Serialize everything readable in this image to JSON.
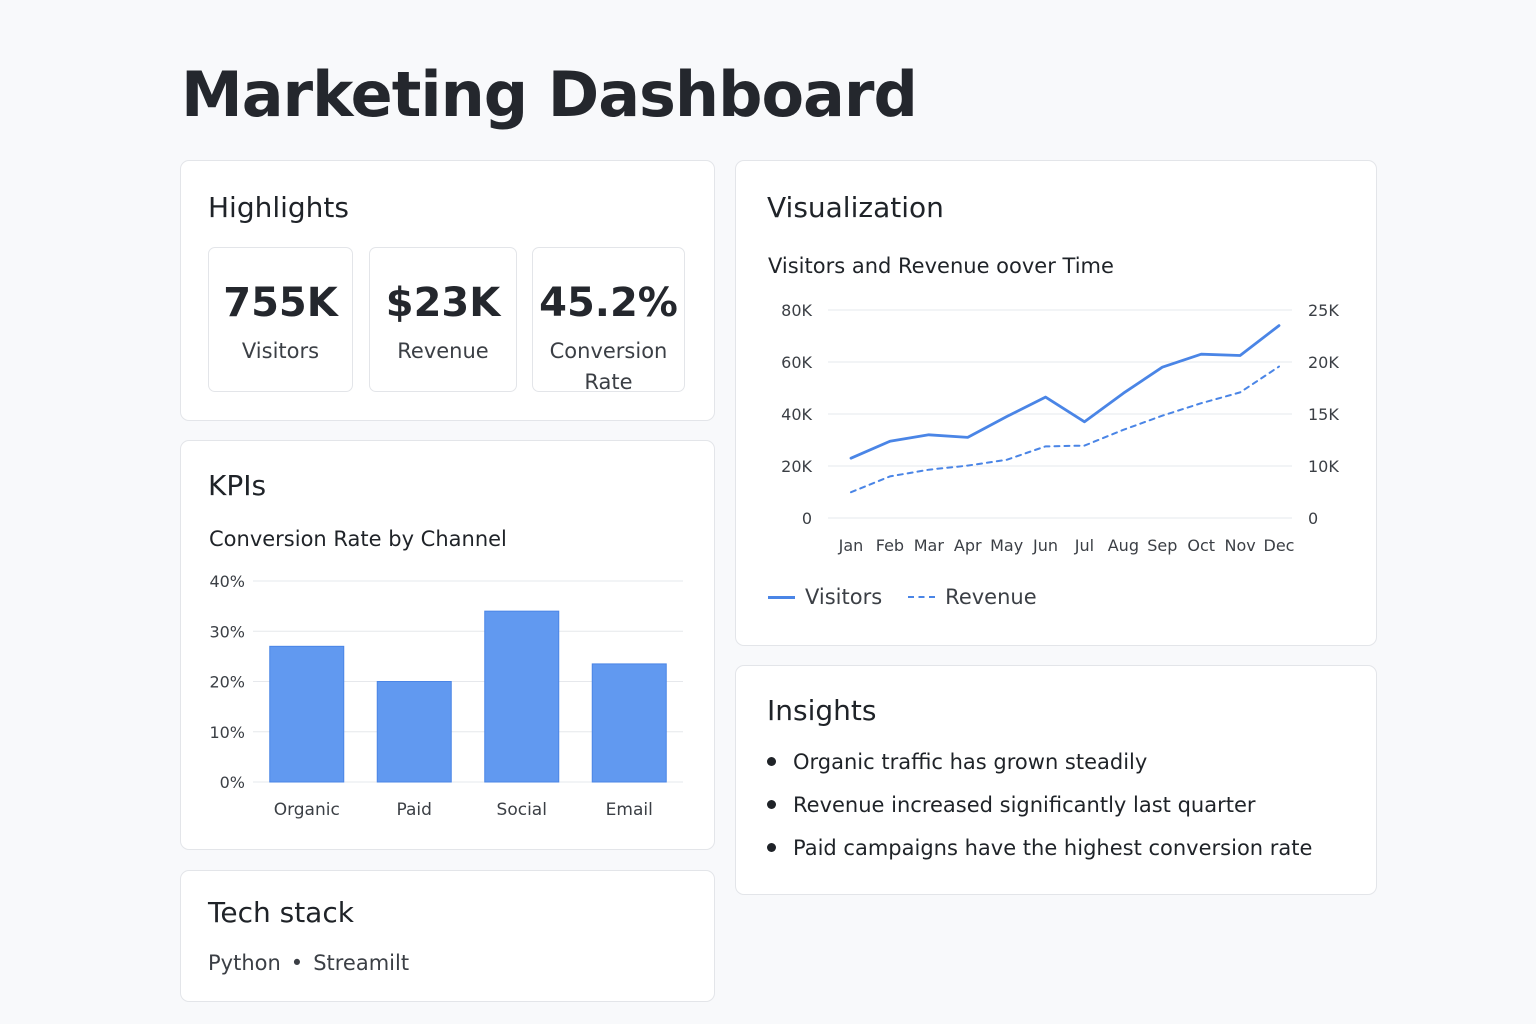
{
  "page": {
    "title": "Marketing Dashboard"
  },
  "colors": {
    "accent": "#4a85e6",
    "bar": "#6199f0",
    "grid": "#e6e8ec"
  },
  "highlights": {
    "title": "Highlights",
    "metrics": [
      {
        "value": "755K",
        "label": "Visitors"
      },
      {
        "value": "$23K",
        "label": "Revenue"
      },
      {
        "value": "45.2%",
        "label": "Conversion Rate"
      }
    ]
  },
  "kpis": {
    "title": "KPIs"
  },
  "visualization": {
    "title": "Visualization"
  },
  "insights": {
    "title": "Insights",
    "items": [
      "Organic traffic has grown steadily",
      "Revenue increased significantly last quarter",
      "Paid campaigns have the highest conversion rate"
    ]
  },
  "tech_stack": {
    "title": "Tech stack",
    "items": [
      "Python",
      "Streamilt"
    ],
    "separator": "•"
  },
  "chart_data": [
    {
      "type": "bar",
      "title": "Conversion Rate by Channel",
      "categories": [
        "Organic",
        "Paid",
        "Social",
        "Email"
      ],
      "values": [
        27,
        20,
        34,
        23.5
      ],
      "ylim": [
        0,
        40
      ],
      "yticks": [
        "0%",
        "10%",
        "20%",
        "30%",
        "40%"
      ],
      "grid": true
    },
    {
      "type": "line",
      "title": "Visitors and Revenue oover Time",
      "categories": [
        "Jan",
        "Feb",
        "Mar",
        "Apr",
        "May",
        "Jun",
        "Jul",
        "Aug",
        "Sep",
        "Oct",
        "Nov",
        "Dec"
      ],
      "series": [
        {
          "name": "Visitors",
          "axis": "left",
          "style": "solid",
          "values": [
            23000,
            29500,
            32000,
            31000,
            39000,
            46500,
            37000,
            48000,
            58000,
            63000,
            62500,
            74000
          ]
        },
        {
          "name": "Revenue",
          "axis": "right",
          "style": "dashed",
          "values": [
            3100,
            5000,
            5800,
            6300,
            7000,
            8600,
            8700,
            10600,
            12300,
            13800,
            15100,
            18200
          ]
        }
      ],
      "ylim_left": [
        0,
        80000
      ],
      "yticks_left": [
        "0",
        "20K",
        "40K",
        "60K",
        "80K"
      ],
      "ylim_right": [
        0,
        25000
      ],
      "yticks_right": [
        "0",
        "10K",
        "15K",
        "20K",
        "25K"
      ],
      "legend": "bottom-left",
      "grid": true
    }
  ]
}
